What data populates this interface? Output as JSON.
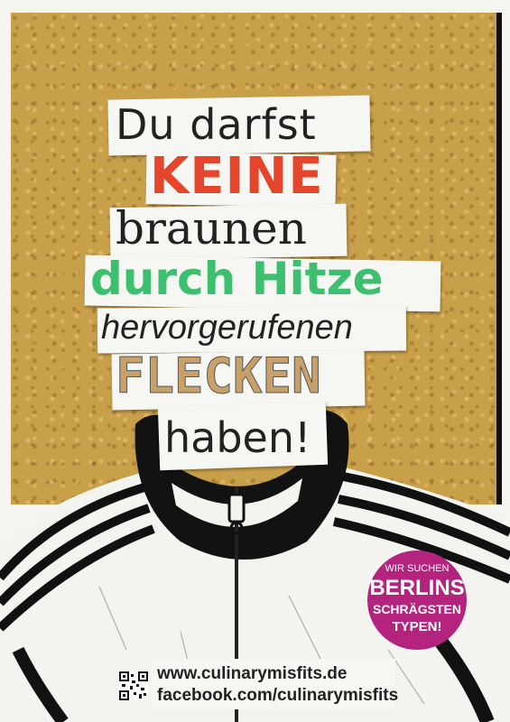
{
  "headline": {
    "line1": "Du darfst",
    "line2": "KEINE",
    "line3": "braunen",
    "line4": "durch Hitze",
    "line5": "hervorgerufenen",
    "line6": "FLECKEN",
    "line7": "haben!"
  },
  "badge": {
    "line1": "WIR SUCHEN",
    "line2": "BERLINS",
    "line3": "SCHRÄGSTEN",
    "line4": "TYPEN!"
  },
  "footer": {
    "website": "www.culinarymisfits.de",
    "facebook": "facebook.com/culinarymisfits"
  },
  "colors": {
    "keine": "#e5452b",
    "hitze": "#3cbf6f",
    "flecken": "#c8a16a",
    "badge": "#b4247f",
    "bread": "#c9a04a"
  }
}
